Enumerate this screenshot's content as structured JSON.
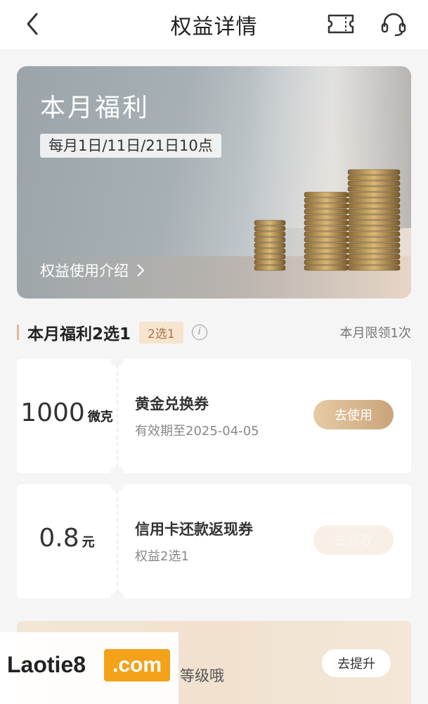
{
  "header": {
    "title": "权益详情",
    "icons": [
      "back-arrow-icon",
      "ticket-icon",
      "headset-icon"
    ]
  },
  "banner": {
    "headline": "本月福利",
    "schedule": "每月1日/11日/21日10点",
    "intro_link": "权益使用介绍",
    "image": "coin-stacks"
  },
  "section": {
    "title": "本月福利2选1",
    "tag": "2选1",
    "limit": "本月限领1次"
  },
  "coupons": [
    {
      "amount": "1000",
      "unit": "微克",
      "name": "黄金兑换券",
      "sub": "有效期至2025-04-05",
      "button": "去使用",
      "state": "active"
    },
    {
      "amount": "0.8",
      "unit": "元",
      "name": "信用卡还款返现券",
      "sub": "权益2选1",
      "button": "去领取",
      "state": "disabled"
    }
  ],
  "upgrade": {
    "text": "等级哦",
    "button": "去提升"
  },
  "watermark": {
    "site": "Laotie8",
    "tld": ".com"
  },
  "colors": {
    "accent": "#caa47a",
    "tag_bg": "#f6e4cf",
    "watermark_orange": "#f4a21a"
  }
}
